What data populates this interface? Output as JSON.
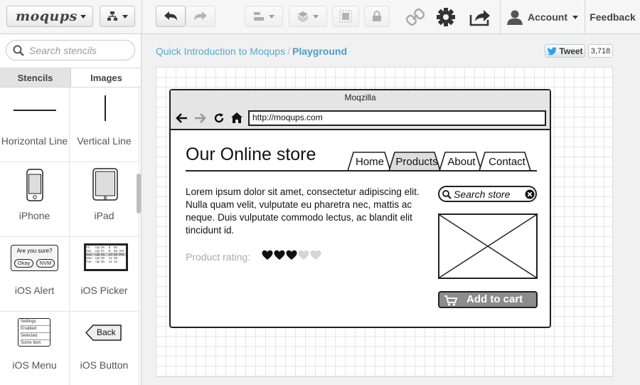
{
  "app": {
    "logo": "moqups"
  },
  "toolbar": {
    "account_label": "Account",
    "feedback_label": "Feedback"
  },
  "sidebar": {
    "search_placeholder": "Search stencils",
    "tabs": [
      "Stencils",
      "Images"
    ],
    "stencils": [
      {
        "label": "Horizontal Line",
        "icon": "horizontal-line"
      },
      {
        "label": "Vertical Line",
        "icon": "vertical-line"
      },
      {
        "label": "iPhone",
        "icon": "iphone"
      },
      {
        "label": "iPad",
        "icon": "ipad"
      },
      {
        "label": "iOS Alert",
        "icon": "ios-alert"
      },
      {
        "label": "iOS Picker",
        "icon": "ios-picker"
      },
      {
        "label": "iOS Menu",
        "icon": "ios-menu"
      },
      {
        "label": "iOS Button",
        "icon": "ios-button"
      }
    ],
    "alert_preview": {
      "text": "Are you sure?",
      "ok": "Okay",
      "cancel": "NVM"
    },
    "picker_preview": {
      "rows": [
        [
          "Fri",
          "Apr 26",
          "8",
          "50",
          ""
        ],
        [
          "Sat",
          "Apr 27",
          "9",
          "55",
          "AM"
        ],
        [
          "Sun",
          "Apr 28",
          "10",
          "00",
          "PM"
        ],
        [
          "Mon",
          "Apr 29",
          "11",
          "05",
          ""
        ],
        [
          "Tue",
          "Apr 30",
          "12",
          "10",
          ""
        ]
      ]
    },
    "menu_preview": {
      "items": [
        "Settings",
        "Enabled",
        "Selected",
        "Some item"
      ]
    },
    "button_preview": {
      "label": "Back"
    }
  },
  "breadcrumb": {
    "parent": "Quick Introduction to Moqups",
    "separator": "/",
    "current": "Playground"
  },
  "social": {
    "tweet_label": "Tweet",
    "tweet_count": "3,718"
  },
  "mockup": {
    "window_title": "Moqzilla",
    "url": "http://moqups.com",
    "store_title": "Our Online store",
    "nav_tabs": [
      "Home",
      "Products",
      "About",
      "Contact"
    ],
    "active_tab": "Products",
    "body_text": "Lorem ipsum dolor sit amet, consectetur adipiscing elit. Nulla quam velit, vulputate eu pharetra nec, mattis ac neque. Duis vulputate commodo lectus, ac blandit elit tincidunt id.",
    "rating_label": "Product rating:",
    "rating": {
      "filled": 3,
      "total": 5
    },
    "search_placeholder": "Search store",
    "add_to_cart_label": "Add to cart"
  },
  "colors": {
    "link": "#5aa8cf",
    "grid": "#e6e6e6",
    "cart_button": "#8c8c8c"
  }
}
